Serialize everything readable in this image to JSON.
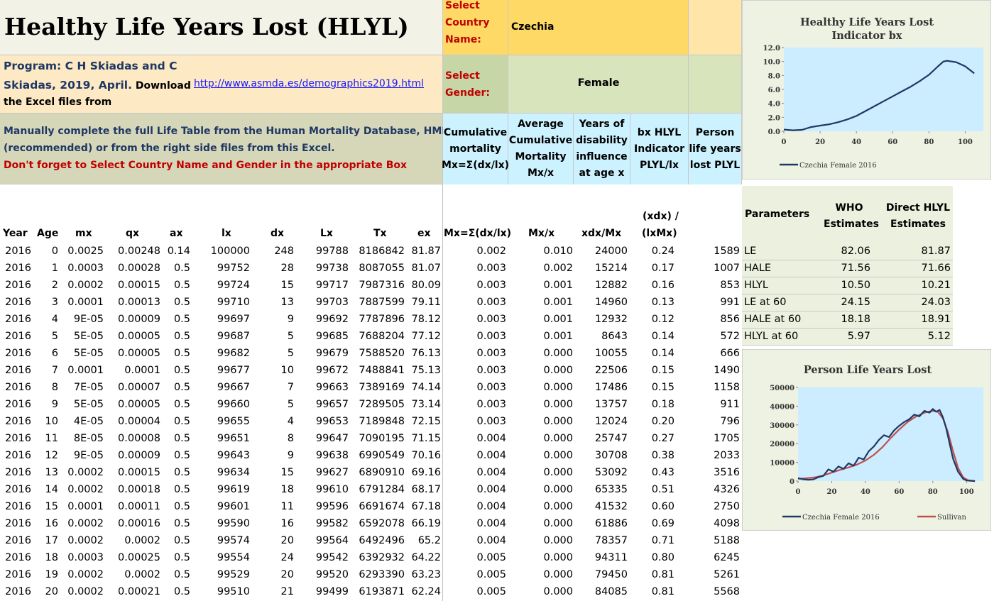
{
  "title": "Healthy Life Years Lost (HLYL)",
  "selectors": {
    "country_label": [
      "Select",
      "Country",
      "Name:"
    ],
    "country_value": "Czechia",
    "gender_label": [
      "Select",
      "Gender:"
    ],
    "gender_value": "Female"
  },
  "program": {
    "line1": "Program: C H Skiadas and C",
    "line2_bold": "Skiadas, 2019, April.",
    "line2_normal": " Download",
    "line3": "the Excel files from",
    "link": "http://www.asmda.es/demographics2019.html"
  },
  "instructions": {
    "line1": "Manually complete the full Life Table from the Human Mortality Database, HMD",
    "line2": "(recommended) or from the right side files from this Excel.",
    "line3": "Don't forget to Select Country Name and Gender in the appropriate Box"
  },
  "upper_headers": [
    [
      "Cumulative",
      "mortality",
      "Mx=Σ(dx/lx)"
    ],
    [
      "Average",
      "Cumulative",
      "Mortality",
      "Mx/x"
    ],
    [
      "Years of",
      "disability",
      "influence",
      "at age x"
    ],
    [
      "bx HLYL",
      "Indicator",
      "PLYL/lx"
    ],
    [
      "Person",
      "life years",
      "lost PLYL"
    ]
  ],
  "table": {
    "headers": [
      "Year",
      "Age",
      "mx",
      "qx",
      "ax",
      "lx",
      "dx",
      "Lx",
      "Tx",
      "ex",
      "Mx=Σ(dx/lx)",
      "Mx/x",
      "xdx/Mx",
      "(xdx) /",
      "(lxMx)"
    ],
    "rows": [
      [
        "2016",
        "0",
        "0.0025",
        "0.00248",
        "0.14",
        "100000",
        "248",
        "99788",
        "8186842",
        "81.87",
        "0.002",
        "0.010",
        "24000",
        "0.24",
        "1589"
      ],
      [
        "2016",
        "1",
        "0.0003",
        "0.00028",
        "0.5",
        "99752",
        "28",
        "99738",
        "8087055",
        "81.07",
        "0.003",
        "0.002",
        "15214",
        "0.17",
        "1007"
      ],
      [
        "2016",
        "2",
        "0.0002",
        "0.00015",
        "0.5",
        "99724",
        "15",
        "99717",
        "7987316",
        "80.09",
        "0.003",
        "0.001",
        "12882",
        "0.16",
        "853"
      ],
      [
        "2016",
        "3",
        "0.0001",
        "0.00013",
        "0.5",
        "99710",
        "13",
        "99703",
        "7887599",
        "79.11",
        "0.003",
        "0.001",
        "14960",
        "0.13",
        "991"
      ],
      [
        "2016",
        "4",
        "9E-05",
        "0.00009",
        "0.5",
        "99697",
        "9",
        "99692",
        "7787896",
        "78.12",
        "0.003",
        "0.001",
        "12932",
        "0.12",
        "856"
      ],
      [
        "2016",
        "5",
        "5E-05",
        "0.00005",
        "0.5",
        "99687",
        "5",
        "99685",
        "7688204",
        "77.12",
        "0.003",
        "0.001",
        "8643",
        "0.14",
        "572"
      ],
      [
        "2016",
        "6",
        "5E-05",
        "0.00005",
        "0.5",
        "99682",
        "5",
        "99679",
        "7588520",
        "76.13",
        "0.003",
        "0.000",
        "10055",
        "0.14",
        "666"
      ],
      [
        "2016",
        "7",
        "0.0001",
        "0.0001",
        "0.5",
        "99677",
        "10",
        "99672",
        "7488841",
        "75.13",
        "0.003",
        "0.000",
        "22506",
        "0.15",
        "1490"
      ],
      [
        "2016",
        "8",
        "7E-05",
        "0.00007",
        "0.5",
        "99667",
        "7",
        "99663",
        "7389169",
        "74.14",
        "0.003",
        "0.000",
        "17486",
        "0.15",
        "1158"
      ],
      [
        "2016",
        "9",
        "5E-05",
        "0.00005",
        "0.5",
        "99660",
        "5",
        "99657",
        "7289505",
        "73.14",
        "0.003",
        "0.000",
        "13757",
        "0.18",
        "911"
      ],
      [
        "2016",
        "10",
        "4E-05",
        "0.00004",
        "0.5",
        "99655",
        "4",
        "99653",
        "7189848",
        "72.15",
        "0.003",
        "0.000",
        "12024",
        "0.20",
        "796"
      ],
      [
        "2016",
        "11",
        "8E-05",
        "0.00008",
        "0.5",
        "99651",
        "8",
        "99647",
        "7090195",
        "71.15",
        "0.004",
        "0.000",
        "25747",
        "0.27",
        "1705"
      ],
      [
        "2016",
        "12",
        "9E-05",
        "0.00009",
        "0.5",
        "99643",
        "9",
        "99638",
        "6990549",
        "70.16",
        "0.004",
        "0.000",
        "30708",
        "0.38",
        "2033"
      ],
      [
        "2016",
        "13",
        "0.0002",
        "0.00015",
        "0.5",
        "99634",
        "15",
        "99627",
        "6890910",
        "69.16",
        "0.004",
        "0.000",
        "53092",
        "0.43",
        "3516"
      ],
      [
        "2016",
        "14",
        "0.0002",
        "0.00018",
        "0.5",
        "99619",
        "18",
        "99610",
        "6791284",
        "68.17",
        "0.004",
        "0.000",
        "65335",
        "0.51",
        "4326"
      ],
      [
        "2016",
        "15",
        "0.0001",
        "0.00011",
        "0.5",
        "99601",
        "11",
        "99596",
        "6691674",
        "67.18",
        "0.004",
        "0.000",
        "41532",
        "0.60",
        "2750"
      ],
      [
        "2016",
        "16",
        "0.0002",
        "0.00016",
        "0.5",
        "99590",
        "16",
        "99582",
        "6592078",
        "66.19",
        "0.004",
        "0.000",
        "61886",
        "0.69",
        "4098"
      ],
      [
        "2016",
        "17",
        "0.0002",
        "0.0002",
        "0.5",
        "99574",
        "20",
        "99564",
        "6492496",
        "65.2",
        "0.004",
        "0.000",
        "78357",
        "0.71",
        "5188"
      ],
      [
        "2016",
        "18",
        "0.0003",
        "0.00025",
        "0.5",
        "99554",
        "24",
        "99542",
        "6392932",
        "64.22",
        "0.005",
        "0.000",
        "94311",
        "0.80",
        "6245"
      ],
      [
        "2016",
        "19",
        "0.0002",
        "0.0002",
        "0.5",
        "99529",
        "20",
        "99520",
        "6293390",
        "63.23",
        "0.005",
        "0.000",
        "79450",
        "0.81",
        "5261"
      ],
      [
        "2016",
        "20",
        "0.0002",
        "0.00021",
        "0.5",
        "99510",
        "21",
        "99499",
        "6193871",
        "62.24",
        "0.005",
        "0.000",
        "84085",
        "0.81",
        "5568"
      ]
    ]
  },
  "parameters": {
    "headers": [
      "Parameters",
      [
        "WHO",
        "Estimates"
      ],
      [
        "Direct HLYL",
        "Estimates"
      ]
    ],
    "rows": [
      [
        "LE",
        "82.06",
        "81.87"
      ],
      [
        "HALE",
        "71.56",
        "71.66"
      ],
      [
        "HLYL",
        "10.50",
        "10.21"
      ],
      [
        "LE at 60",
        "24.15",
        "24.03"
      ],
      [
        "HALE at 60",
        "18.18",
        "18.91"
      ],
      [
        "HLYL at 60",
        "5.97",
        "5.12"
      ]
    ]
  },
  "chart_data": [
    {
      "type": "line",
      "title": "Healthy Life Years Lost Indicator bx",
      "xlim": [
        0,
        110
      ],
      "ylim": [
        0,
        12
      ],
      "xticks": [
        "0",
        "20",
        "40",
        "60",
        "80",
        "100"
      ],
      "yticks": [
        "0.0",
        "2.0",
        "4.0",
        "6.0",
        "8.0",
        "10.0",
        "12.0"
      ],
      "legend_position": "bottom",
      "series": [
        {
          "name": "Czechia Female 2016",
          "color": "#1f3864",
          "x": [
            0,
            5,
            10,
            15,
            20,
            25,
            30,
            35,
            40,
            45,
            50,
            55,
            60,
            65,
            70,
            75,
            80,
            85,
            88,
            90,
            95,
            100,
            105
          ],
          "y": [
            0.24,
            0.14,
            0.2,
            0.6,
            0.81,
            1.0,
            1.3,
            1.7,
            2.2,
            2.9,
            3.6,
            4.3,
            5.0,
            5.7,
            6.4,
            7.2,
            8.1,
            9.3,
            10.0,
            10.1,
            9.9,
            9.3,
            8.3
          ]
        }
      ]
    },
    {
      "type": "line",
      "title": "Person Life Years Lost",
      "xlim": [
        0,
        110
      ],
      "ylim": [
        0,
        50000
      ],
      "xticks": [
        "0",
        "20",
        "40",
        "60",
        "80",
        "100"
      ],
      "yticks": [
        "0",
        "10000",
        "20000",
        "30000",
        "40000",
        "50000"
      ],
      "legend_position": "bottom",
      "series": [
        {
          "name": "Czechia Female 2016",
          "color": "#1f3864",
          "x": [
            0,
            3,
            6,
            9,
            12,
            15,
            18,
            21,
            24,
            27,
            30,
            33,
            36,
            39,
            42,
            45,
            48,
            51,
            54,
            57,
            60,
            63,
            66,
            69,
            72,
            75,
            78,
            80,
            82,
            84,
            86,
            88,
            90,
            92,
            95,
            98,
            100,
            105
          ],
          "y": [
            1589,
            991,
            666,
            911,
            2033,
            2750,
            6245,
            5000,
            7800,
            6500,
            9500,
            8200,
            12500,
            11500,
            16000,
            18500,
            22000,
            24500,
            23500,
            27000,
            29500,
            31500,
            33000,
            35500,
            34500,
            37500,
            36500,
            38500,
            37000,
            38000,
            34000,
            28000,
            20000,
            12000,
            5000,
            1200,
            300,
            0
          ]
        },
        {
          "name": "Sullivan",
          "color": "#c0504d",
          "x": [
            0,
            5,
            10,
            15,
            20,
            25,
            30,
            35,
            40,
            45,
            50,
            55,
            60,
            65,
            70,
            75,
            80,
            83,
            86,
            89,
            92,
            95,
            98,
            101,
            105
          ],
          "y": [
            1200,
            1500,
            2000,
            3000,
            4500,
            6000,
            7300,
            8800,
            11000,
            14000,
            18000,
            23000,
            27500,
            31500,
            34500,
            36500,
            37500,
            37000,
            33500,
            26000,
            16000,
            7000,
            2000,
            400,
            0
          ]
        }
      ]
    }
  ]
}
